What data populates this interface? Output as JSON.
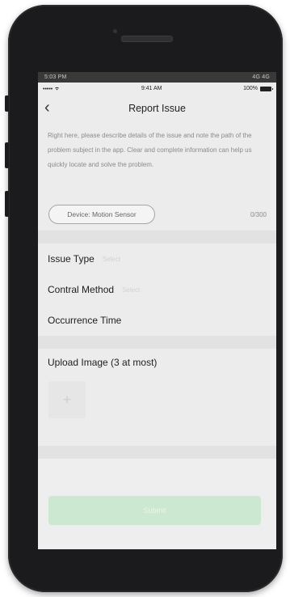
{
  "android_status": {
    "time": "5:03 PM",
    "right": "4G 4G"
  },
  "ios_status": {
    "signal": "•••••",
    "time": "9:41 AM",
    "battery": "100%"
  },
  "nav": {
    "back": "‹",
    "title": "Report Issue"
  },
  "description": {
    "text": "Right here, please describe details of the issue and note the path of the problem subject in the app. Clear and complete information can help us quickly locate and solve the problem.",
    "device_tag": "Device: Motion Sensor",
    "counter": "0/300"
  },
  "form": {
    "issue_type": {
      "label": "Issue Type",
      "value": "Select"
    },
    "control_method": {
      "label": "Contral Method",
      "value": "Select"
    },
    "occurrence_time": {
      "label": "Occurrence Time",
      "value": ""
    }
  },
  "upload": {
    "label": "Upload Image (3 at most)",
    "add_symbol": "+"
  },
  "submit": {
    "label": "Submit"
  },
  "colors": {
    "submit_bg": "#cde8d1",
    "screen_bg": "#ececec"
  },
  "icons": [
    "back-chevron-icon",
    "wifi-icon",
    "battery-icon",
    "add-image-icon"
  ]
}
